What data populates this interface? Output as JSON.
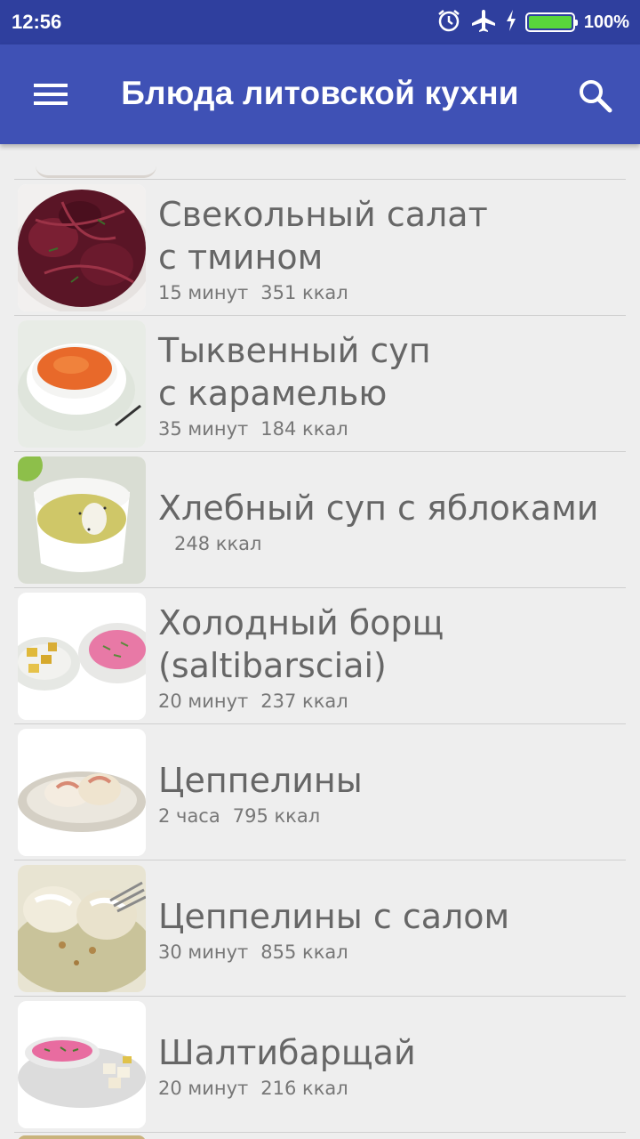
{
  "status_bar": {
    "time": "12:56",
    "battery_percent_label": "100%",
    "battery_level": 1.0,
    "icons": [
      "alarm-icon",
      "airplane-mode-icon",
      "charging-icon",
      "battery-icon"
    ]
  },
  "app_bar": {
    "title": "Блюда литовской кухни",
    "menu_icon": "hamburger-menu-icon",
    "search_icon": "search-icon"
  },
  "recipes": [
    {
      "name_line1": "Свекольный салат",
      "name_line2": "с тмином",
      "time": "15 минут",
      "kcal": "351 ккал",
      "image": "beet-salad"
    },
    {
      "name_line1": "Тыквенный суп",
      "name_line2": "с карамелью",
      "time": "35 минут",
      "kcal": "184 ккал",
      "image": "pumpkin-soup"
    },
    {
      "name_line1": "Хлебный суп с яблоками",
      "name_line2": "",
      "time": "",
      "kcal": "248 ккал",
      "image": "bread-soup"
    },
    {
      "name_line1": "Холодный борщ",
      "name_line2": "(saltibarsciai)",
      "time": "20 минут",
      "kcal": "237 ккал",
      "image": "cold-borscht"
    },
    {
      "name_line1": "Цеппелины",
      "name_line2": "",
      "time": "2 часа",
      "kcal": "795 ккал",
      "image": "cepelinai"
    },
    {
      "name_line1": "Цеппелины с салом",
      "name_line2": "",
      "time": "30 минут",
      "kcal": "855 ккал",
      "image": "cepelinai-with-lard"
    },
    {
      "name_line1": "Шалтибарщай",
      "name_line2": "",
      "time": "20 минут",
      "kcal": "216 ккал",
      "image": "saltibarsciai"
    }
  ],
  "colors": {
    "status_bar": "#2f3f9e",
    "app_bar": "#3f51b5",
    "list_background": "#eeeeee",
    "text_primary": "#666666",
    "battery_fill": "#59d63b"
  }
}
